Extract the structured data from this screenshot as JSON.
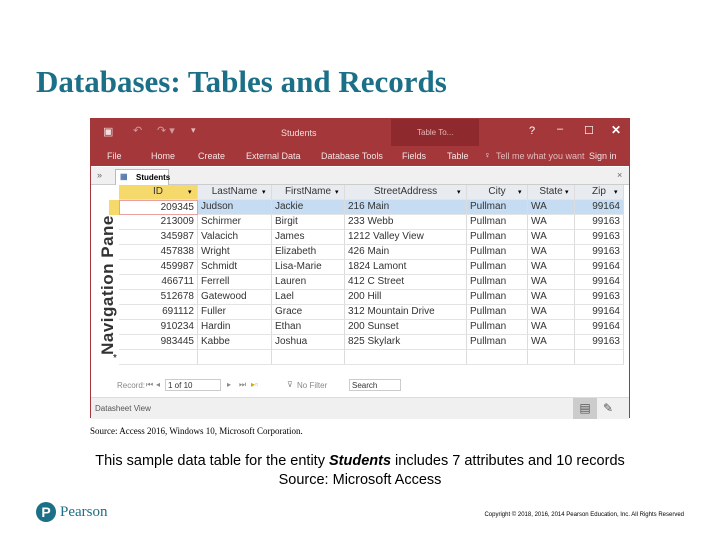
{
  "slide": {
    "title": "Databases: Tables and Records",
    "source": "Source: Access 2016, Windows 10, Microsoft Corporation.",
    "caption_pre": "This sample data table for the entity ",
    "caption_entity": "Students",
    "caption_post": " includes 7 attributes and 10 records",
    "caption_source": "Source: Microsoft Access",
    "logo": "Pearson",
    "copyright": "Copyright © 2018, 2016, 2014 Pearson Education, Inc. All Rights Reserved"
  },
  "window": {
    "title": "Students",
    "context_tab": "Table To...",
    "help": "?",
    "ribbon": [
      "File",
      "Home",
      "Create",
      "External Data",
      "Database Tools",
      "Fields",
      "Table"
    ],
    "tell_me": "Tell me what you want",
    "sign_in": "Sign in",
    "accent": "#a4373a"
  },
  "doc_tab": "Students",
  "nav_pane": "Navigation Pane",
  "table": {
    "columns": [
      "ID",
      "LastName",
      "FirstName",
      "StreetAddress",
      "City",
      "State",
      "Zip"
    ],
    "rows": [
      [
        "209345",
        "Judson",
        "Jackie",
        "216 Main",
        "Pullman",
        "WA",
        "99164"
      ],
      [
        "213009",
        "Schirmer",
        "Birgit",
        "233 Webb",
        "Pullman",
        "WA",
        "99163"
      ],
      [
        "345987",
        "Valacich",
        "James",
        "1212 Valley View",
        "Pullman",
        "WA",
        "99163"
      ],
      [
        "457838",
        "Wright",
        "Elizabeth",
        "426 Main",
        "Pullman",
        "WA",
        "99163"
      ],
      [
        "459987",
        "Schmidt",
        "Lisa-Marie",
        "1824 Lamont",
        "Pullman",
        "WA",
        "99164"
      ],
      [
        "466711",
        "Ferrell",
        "Lauren",
        "412 C Street",
        "Pullman",
        "WA",
        "99164"
      ],
      [
        "512678",
        "Gatewood",
        "Lael",
        "200 Hill",
        "Pullman",
        "WA",
        "99163"
      ],
      [
        "691112",
        "Fuller",
        "Grace",
        "312 Mountain Drive",
        "Pullman",
        "WA",
        "99164"
      ],
      [
        "910234",
        "Hardin",
        "Ethan",
        "200 Sunset",
        "Pullman",
        "WA",
        "99164"
      ],
      [
        "983445",
        "Kabbe",
        "Joshua",
        "825 Skylark",
        "Pullman",
        "WA",
        "99163"
      ]
    ]
  },
  "record_bar": {
    "label": "Record:",
    "position": "1 of 10",
    "filter": "No Filter",
    "search": "Search"
  },
  "status": "Datasheet View"
}
